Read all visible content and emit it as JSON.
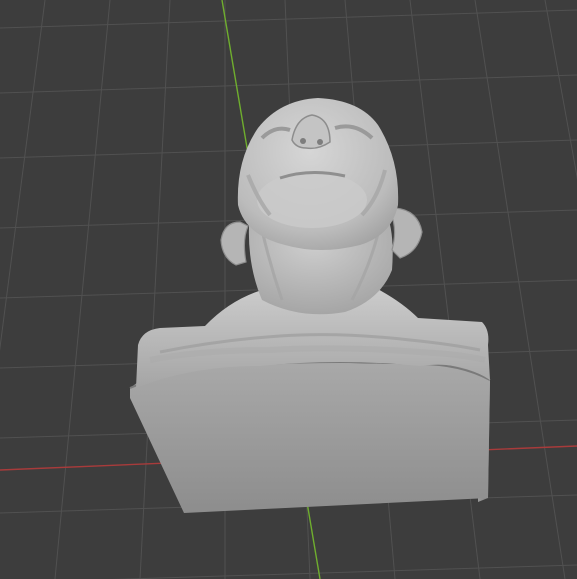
{
  "viewport": {
    "background": "#3d3d3d",
    "grid_color": "#515151",
    "x_axis_color": "#a83b3b",
    "y_axis_color": "#6fae2e",
    "mesh_color": "#bdbdbd",
    "mesh_shadow": "#8f8f8f",
    "mesh_highlight": "#d8d8d8"
  }
}
